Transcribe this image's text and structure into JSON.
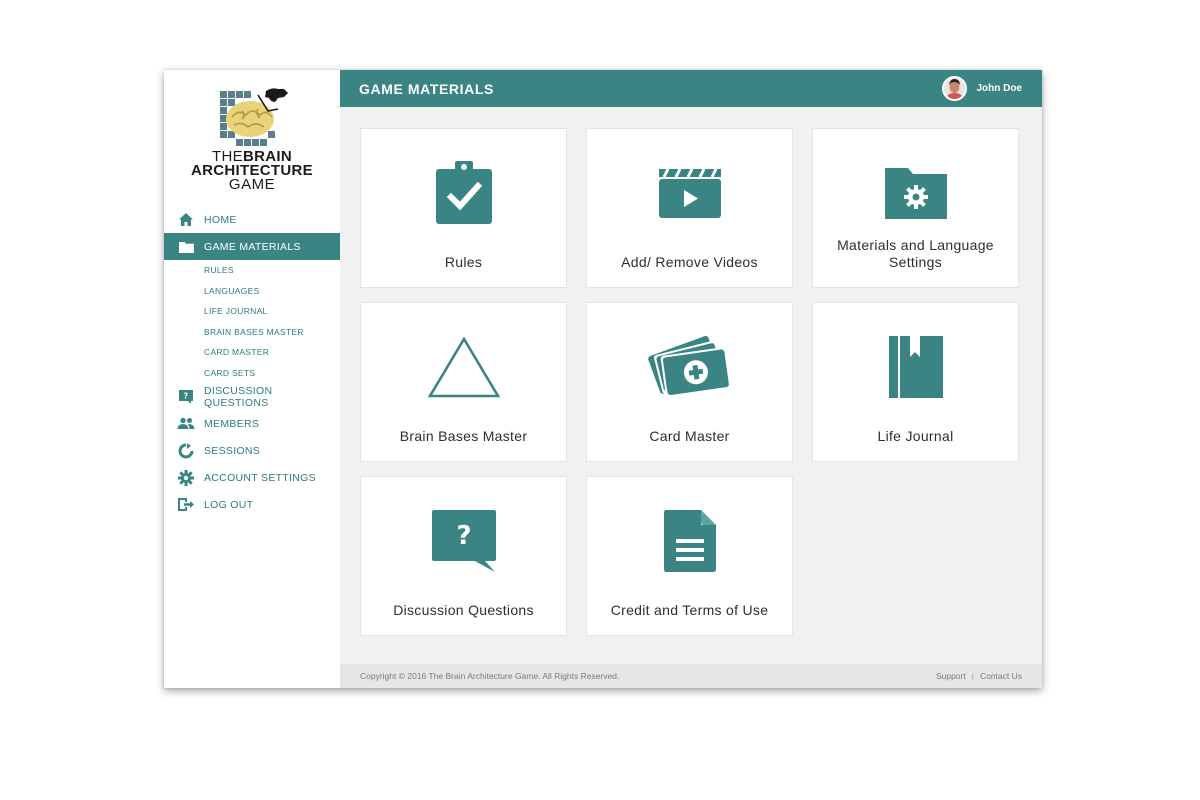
{
  "brand": {
    "logo_alt": "The Brain Architecture Game logo",
    "line1_thin": "THE",
    "line1_bold": "BRAIN",
    "line2": "ARCHITECTURE",
    "line3": "GAME"
  },
  "sidebar": {
    "items": [
      {
        "label": "HOME",
        "icon": "home-icon"
      },
      {
        "label": "GAME MATERIALS",
        "icon": "folder-icon",
        "active": true
      },
      {
        "label": "DISCUSSION QUESTIONS",
        "icon": "question-bubble-icon"
      },
      {
        "label": "MEMBERS",
        "icon": "people-icon"
      },
      {
        "label": "SESSIONS",
        "icon": "refresh-icon"
      },
      {
        "label": "ACCOUNT SETTINGS",
        "icon": "gear-icon"
      },
      {
        "label": "LOG OUT",
        "icon": "logout-icon"
      }
    ],
    "subitems": [
      "RULES",
      "LANGUAGES",
      "LIFE JOURNAL",
      "BRAIN BASES MASTER",
      "CARD MASTER",
      "CARD SETS"
    ]
  },
  "header": {
    "title": "GAME MATERIALS",
    "user_name": "John Doe"
  },
  "cards": [
    {
      "label": "Rules",
      "icon": "clipboard-check-icon"
    },
    {
      "label": "Add/ Remove Videos",
      "icon": "video-clapper-icon"
    },
    {
      "label": "Materials and Language Settings",
      "icon": "folder-gear-icon"
    },
    {
      "label": "Brain Bases Master",
      "icon": "triangle-icon"
    },
    {
      "label": "Card Master",
      "icon": "card-stack-icon"
    },
    {
      "label": "Life Journal",
      "icon": "journal-icon"
    },
    {
      "label": "Discussion Questions",
      "icon": "question-bubble-icon"
    },
    {
      "label": "Credit and Terms of Use",
      "icon": "document-icon"
    }
  ],
  "footer": {
    "copyright": "Copyright © 2016 The Brain Architecture Game. All Rights Reserved.",
    "support": "Support",
    "separator": "|",
    "contact": "Contact Us"
  },
  "colors": {
    "accent": "#3a8584",
    "text_teal": "#2c7b7a",
    "background": "#f1f1f1"
  }
}
